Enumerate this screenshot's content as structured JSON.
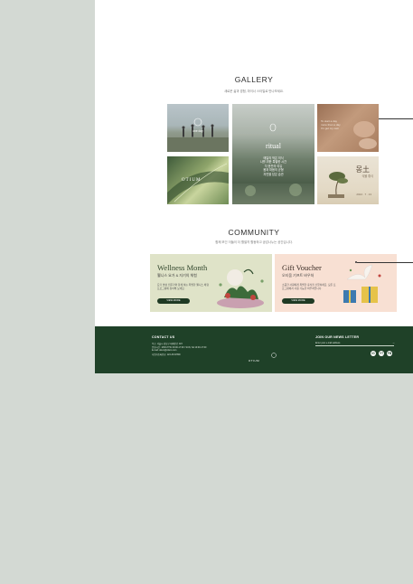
{
  "gallery": {
    "title": "GALLERY",
    "subtitle": "새로운 삶과 경험, 마이너 스타일로 만나보세요.",
    "tile1_caption": "one day",
    "tile2_logo": "OTIUM",
    "tile3_title": "ritual",
    "tile3_lines": [
      "매일의 작은 의식",
      "나를 위한 특별한 시간",
      "차 한잔의 여유",
      "몸과 마음의 균형",
      "자연을 담은 습관"
    ],
    "tile4_lines": [
      "To start a day",
      "more than a day",
      "I'm get my own"
    ],
    "tile5_kr": "몽土",
    "tile5_sub": "식물 휴식",
    "tile5_small": "2024 . 7 . 13"
  },
  "community": {
    "title": "COMMUNITY",
    "subtitle": "함께 모인 이들이 더 활발히 활동하고 공감나누는 공간입니다.",
    "cards": [
      {
        "title": "Wellness Month",
        "subtitle": "웰니스 요가 & 자기의 체험",
        "desc": "요가 명상 전문가와 함께 하는 특별한 웰니스 체험 프로그램에 참여해 보세요.",
        "button": "VIEW MORE"
      },
      {
        "title": "Gift Voucher",
        "subtitle": "오티움 기프트 바우처",
        "desc": "소중한 사람에게 특별한 휴식을 선물하세요. 모든 프로그램에서 사용 가능한 바우처입니다.",
        "button": "VIEW MORE"
      }
    ]
  },
  "footer": {
    "contact_heading": "CONTACT US",
    "contact_lines": [
      "주소: 서울시 강남구 테헤란로 123",
      "운영시간 : MON-THU 09:00-17:00 / SUN, SA 10:00-17:00",
      "E-mail: otium@otium.com",
      "사업자등록번호: 123-45-67890"
    ],
    "newsletter_heading": "JOIN OUR NEWS LETTER",
    "newsletter_placeholder": "Enter your e-mail address",
    "newsletter_arrow": "→",
    "logo_text": "OTIUM",
    "social": [
      "IG",
      "YT",
      "FB"
    ]
  }
}
